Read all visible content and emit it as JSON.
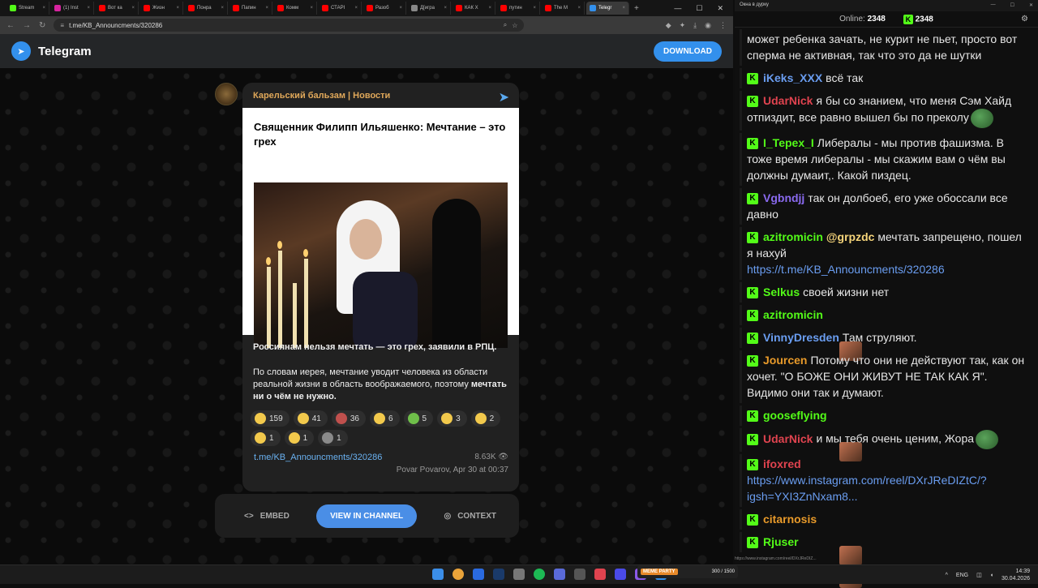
{
  "browser": {
    "tabs": [
      {
        "label": "Stream",
        "color": "#53fc18"
      },
      {
        "label": "(1) Inst",
        "color": "#d6249f"
      },
      {
        "label": "Вот ка",
        "color": "#ff0000"
      },
      {
        "label": "Жизн",
        "color": "#ff0000"
      },
      {
        "label": "Понра",
        "color": "#ff0000"
      },
      {
        "label": "Папин",
        "color": "#ff0000"
      },
      {
        "label": "Комм",
        "color": "#ff0000"
      },
      {
        "label": "СТАРІ",
        "color": "#ff0000"
      },
      {
        "label": "Разоб",
        "color": "#ff0000"
      },
      {
        "label": "Д[игра",
        "color": "#888888"
      },
      {
        "label": "КАК Х",
        "color": "#ff0000"
      },
      {
        "label": "путин",
        "color": "#ff0000"
      },
      {
        "label": "The M",
        "color": "#ff0000"
      },
      {
        "label": "Telegr",
        "color": "#3390ec",
        "active": true
      }
    ],
    "url": "t.me/KB_Announcments/320286"
  },
  "telegram": {
    "brand": "Telegram",
    "download_label": "DOWNLOAD"
  },
  "post": {
    "channel": "Карельский бальзам | Новости",
    "title": "Священник Филипп Ильяшенко: Мечтание – это грех",
    "lead": "Россиянам нельзя мечтать — это грех, заявили в РПЦ.",
    "body_part1": "По словам иерея, мечтание уводит человека из области реальной жизни в область воображаемого, поэтому ",
    "body_bold": "мечтать ни о чём не нужно.",
    "reactions_row1": [
      {
        "count": "159",
        "color": "#f2c94c"
      },
      {
        "count": "41",
        "color": "#f2c94c"
      },
      {
        "count": "36",
        "color": "#c0504d"
      },
      {
        "count": "6",
        "color": "#f2c94c"
      },
      {
        "count": "5",
        "color": "#6fbf4a"
      },
      {
        "count": "3",
        "color": "#f2c94c"
      },
      {
        "count": "2",
        "color": "#f2c94c"
      }
    ],
    "reactions_row2": [
      {
        "count": "1",
        "color": "#f2c94c"
      },
      {
        "count": "1",
        "color": "#f2c94c"
      },
      {
        "count": "1",
        "color": "#8a8a8a"
      }
    ],
    "link": "t.me/KB_Announcments/320286",
    "views": "8.63K",
    "author_date": "Povar Povarov, Apr 30 at 00:37"
  },
  "actions": {
    "embed": "EMBED",
    "view": "VIEW IN CHANNEL",
    "context": "CONTEXT"
  },
  "chat": {
    "window_title": "Окна в дурку",
    "online_label": "Online:",
    "online_count": "2348",
    "kick_count": "2348",
    "messages": [
      {
        "user": "",
        "color": "#ffffff",
        "text": "может ребенка зачать, не курит не пьет, просто вот сперма не активная, так что это да не шутки"
      },
      {
        "user": "iKeks_XXX",
        "color": "#6a9df0",
        "text": "всё так"
      },
      {
        "user": "UdarNick",
        "color": "#e0434f",
        "text": "я бы со знанием, что меня Сэм Хайд отпиздит, все равно вышел бы по преколу",
        "emote": "pepe"
      },
      {
        "user": "I_Tepex_I",
        "color": "#53fc18",
        "text": "Либералы - мы против фашизма. В тоже время либералы - мы скажим вам о чём вы должны думаит,. Какой пиздец."
      },
      {
        "user": "Vgbndjj",
        "color": "#8a6af0",
        "text": "так он долбоеб, его уже обоссали все давно"
      },
      {
        "user": "azitromicin",
        "color": "#53fc18",
        "mention": "@grpzdc",
        "text": "мечтать запрещено, пошел я нахуй",
        "url": "https://t.me/KB_Announcments/320286"
      },
      {
        "user": "Selkus",
        "color": "#53fc18",
        "text": "своей жизни нет"
      },
      {
        "user": "azitromicin",
        "color": "#53fc18",
        "text": "",
        "emote": "face"
      },
      {
        "user": "VinnyDresden",
        "color": "#6a9df0",
        "text": "Там струляют."
      },
      {
        "user": "Jourcen",
        "color": "#e89a2a",
        "text": "Потому что они не действуют так, как он хочет. \"О БОЖЕ ОНИ ЖИВУТ НЕ ТАК КАК Я\". Видимо они так и думают."
      },
      {
        "user": "gooseflying",
        "color": "#53fc18",
        "text": "",
        "emote": "face"
      },
      {
        "user": "UdarNick",
        "color": "#e0434f",
        "text": "и мы тебя очень ценим, Жора",
        "emote": "pepe"
      },
      {
        "user": "ifoxred",
        "color": "#e0434f",
        "text": "",
        "url": "https://www.instagram.com/reel/DXrJReDIZtC/?igsh=YXI3ZnNxam8..."
      },
      {
        "user": "citarnosis",
        "color": "#e89a2a",
        "text": "",
        "emote": "face"
      },
      {
        "user": "Rjuser",
        "color": "#53fc18",
        "text": "",
        "emote": "face"
      }
    ]
  },
  "statusbar_url": "https://www.instagram.com/reel/DXrJReDIZ...",
  "kickbar": {
    "label": "MEME PARTY",
    "progress": "300 / 1500"
  },
  "taskbar": {
    "lang": "ENG",
    "time": "14:39",
    "date": "30.04.2026"
  }
}
